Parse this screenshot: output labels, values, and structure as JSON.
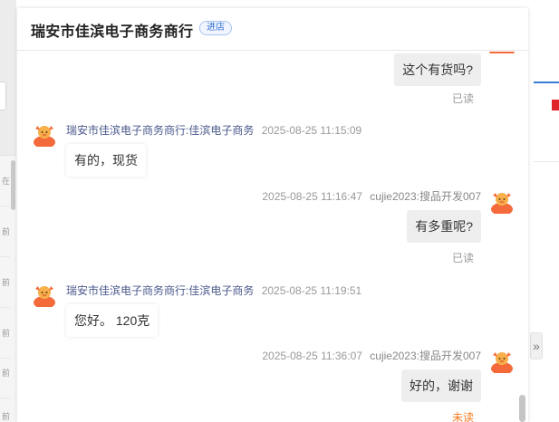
{
  "header": {
    "shop_name": "瑞安市佳滨电子商务商行",
    "enter_shop_label": "进店"
  },
  "background_left": {
    "rows": [
      "在",
      "前",
      "前",
      "前",
      "前",
      "前"
    ]
  },
  "background_right": {
    "expand_icon": "double-chevron-right-icon",
    "expand_glyph": "»"
  },
  "messages": [
    {
      "side": "right",
      "text": "这个有货吗?",
      "status": "已读"
    },
    {
      "side": "left",
      "sender": "瑞安市佳滨电子商务商行:佳滨电子商务",
      "time": "2025-08-25 11:15:09",
      "text": "有的，现货"
    },
    {
      "side": "right",
      "time": "2025-08-25 11:16:47",
      "sender": "cujie2023:搜品开发007",
      "text": "有多重呢?",
      "status": "已读"
    },
    {
      "side": "left",
      "sender": "瑞安市佳滨电子商务商行:佳滨电子商务",
      "time": "2025-08-25 11:19:51",
      "text": "您好。 120克"
    },
    {
      "side": "right",
      "time": "2025-08-25 11:36:07",
      "sender": "cujie2023:搜品开发007",
      "text": "好的，谢谢",
      "status": "未读"
    }
  ],
  "colors": {
    "sender_name": "#4a5a8c",
    "unread": "#f57c1f",
    "accent_blue": "#2f6fd1",
    "avatar_orange": "#f46a3a"
  }
}
